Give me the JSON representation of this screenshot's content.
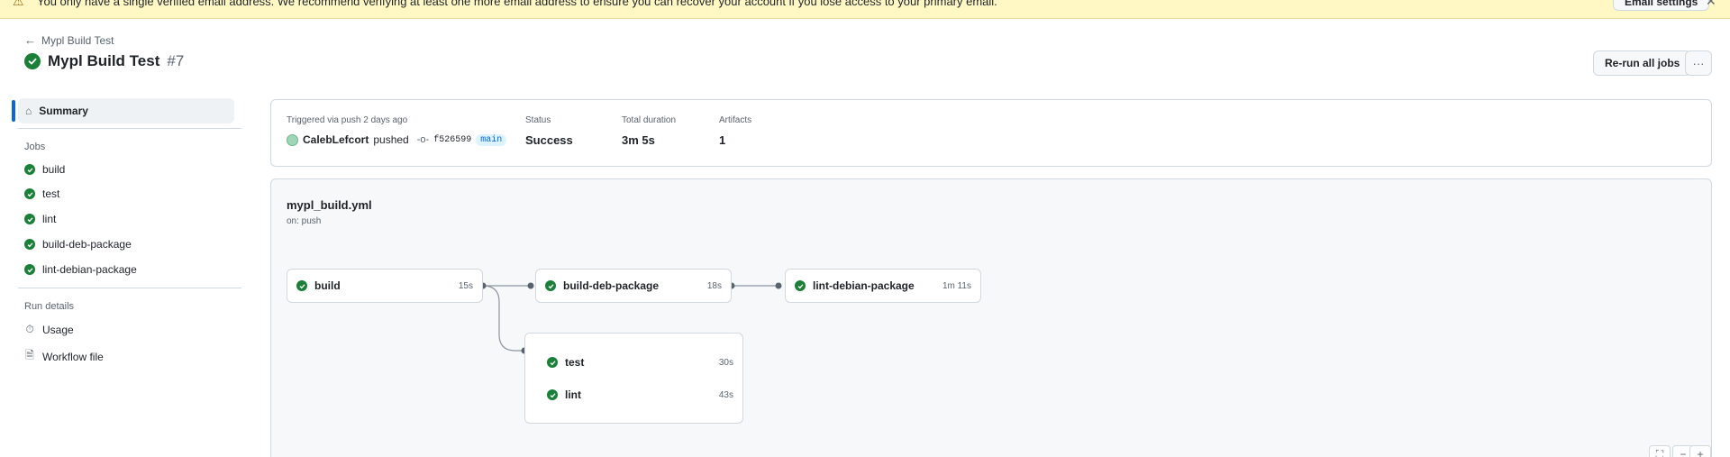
{
  "banner": {
    "text": "You only have a single verified email address. We recommend verifying at least one more email address to ensure you can recover your account if you lose access to your primary email.",
    "button_label": "Email settings",
    "icon": "alert-icon",
    "close_icon": "close-icon"
  },
  "header": {
    "back_label": "Mypl Build Test",
    "title": "Mypl Build Test",
    "run_number": "#7",
    "rerun_label": "Re-run all jobs",
    "more_label": "···"
  },
  "sidebar": {
    "summary_label": "Summary",
    "jobs_heading": "Jobs",
    "jobs": [
      {
        "label": "build"
      },
      {
        "label": "test"
      },
      {
        "label": "lint"
      },
      {
        "label": "build-deb-package"
      },
      {
        "label": "lint-debian-package"
      }
    ],
    "run_details_heading": "Run details",
    "run_details": [
      {
        "label": "Usage",
        "icon": "stopwatch-icon"
      },
      {
        "label": "Workflow file",
        "icon": "file-icon"
      }
    ]
  },
  "summary": {
    "trigger_label": "Triggered via push 2 days ago",
    "actor": "CalebLefcort",
    "action": "pushed",
    "commit_sha": "f526599",
    "branch": "main",
    "status_label": "Status",
    "status_value": "Success",
    "duration_label": "Total duration",
    "duration_value": "3m 5s",
    "artifacts_label": "Artifacts",
    "artifacts_value": "1"
  },
  "workflow": {
    "file_name": "mypl_build.yml",
    "trigger": "on: push",
    "jobs": [
      {
        "name": "build",
        "duration": "15s"
      },
      {
        "name": "build-deb-package",
        "duration": "18s"
      },
      {
        "name": "lint-debian-package",
        "duration": "1m 11s"
      },
      {
        "name": "test",
        "duration": "30s"
      },
      {
        "name": "lint",
        "duration": "43s"
      }
    ],
    "zoom": {
      "fullscreen": "⛶",
      "minus": "−",
      "plus": "+"
    }
  },
  "colors": {
    "success": "#1a7f37",
    "accent": "#0969da",
    "banner_bg": "#fff8c5"
  }
}
